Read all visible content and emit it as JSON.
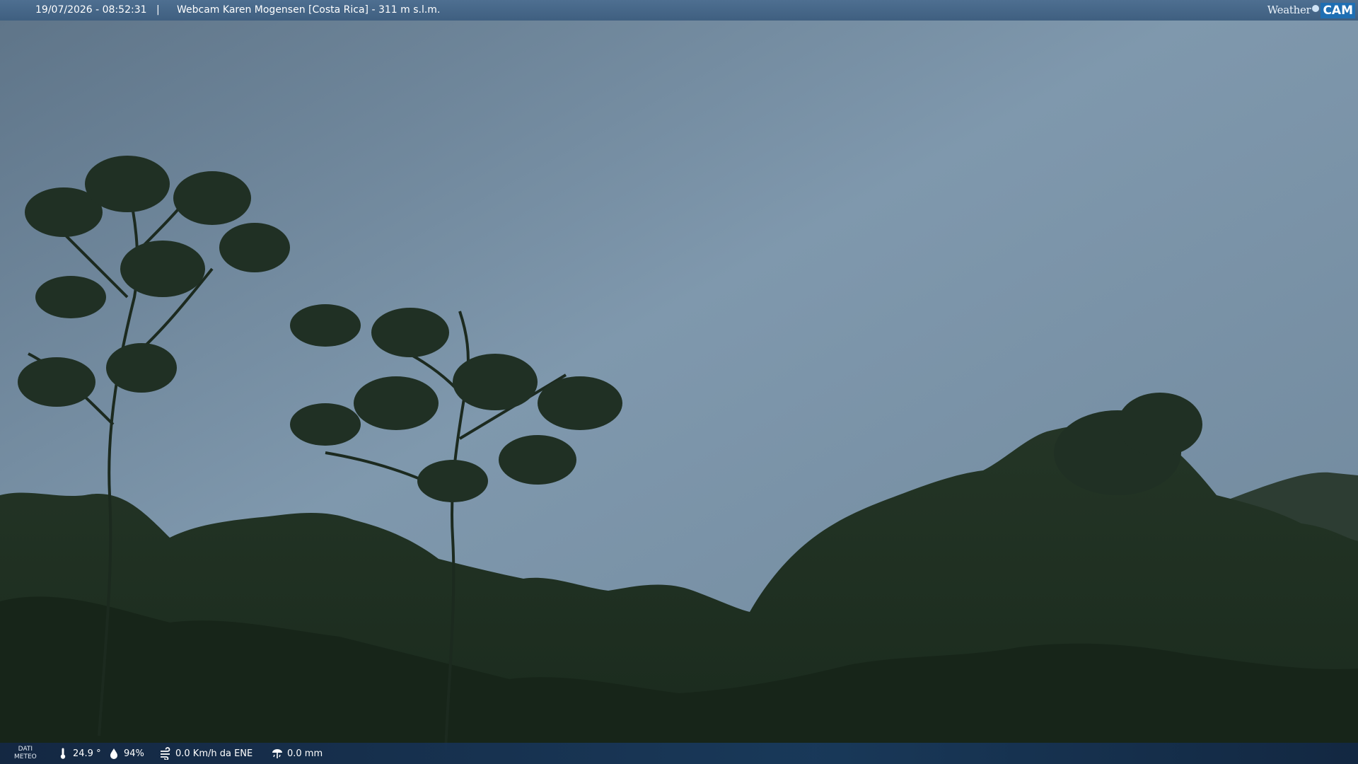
{
  "overlay": {
    "datetime": "19/07/2026 - 08:52:31",
    "separator": "|",
    "location": "Webcam Karen Mogensen [Costa Rica]  - 311 m s.l.m.",
    "logo_weather": "Weather",
    "logo_cam": "CAM"
  },
  "meteo": {
    "label_line1": "DATI",
    "label_line2": "METEO",
    "temperature": "24.9 °",
    "humidity": "94%",
    "wind": "0.0 Km/h da ENE",
    "rain": "0.0 mm"
  },
  "icons": {
    "temperature": "thermometer-icon",
    "humidity": "humidity-icon",
    "wind": "wind-icon",
    "rain": "rain-gauge-icon"
  },
  "colors": {
    "topbar": "#4e6f91",
    "sky": "#7a93a8",
    "forest": "#1f2e22"
  }
}
